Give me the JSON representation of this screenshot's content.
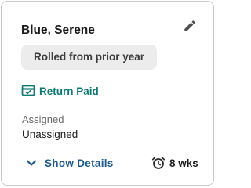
{
  "card": {
    "client_name": "Blue, Serene",
    "edit_icon": "pencil-icon",
    "status_chip": "Rolled from prior year",
    "return_status": {
      "icon": "payment-card-icon",
      "label": "Return Paid",
      "color": "#0d7a74"
    },
    "assigned": {
      "label": "Assigned",
      "value": "Unassigned"
    },
    "show_details": {
      "icon": "chevron-down-icon",
      "label": "Show Details",
      "color": "#1d5a94"
    },
    "duration": {
      "icon": "alarm-clock-icon",
      "label": "8 wks"
    }
  }
}
